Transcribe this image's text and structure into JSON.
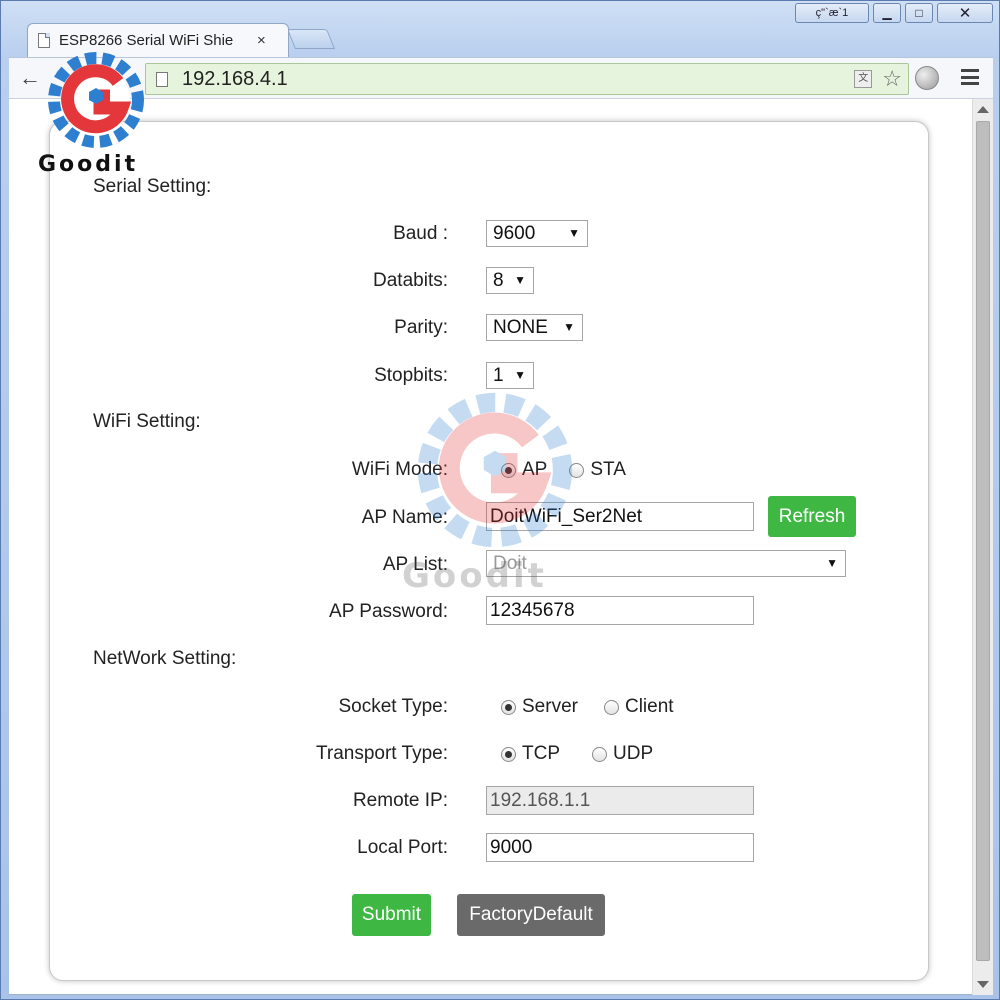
{
  "browser": {
    "tab_title": "ESP8266 Serial WiFi Shie",
    "tab_close": "×",
    "url": "192.168.4.1",
    "user_badge": "ç\"`æ`1",
    "min_glyph": "▁",
    "max_glyph": "□",
    "close_glyph": "✕",
    "back_glyph": "←",
    "reload_glyph": "C",
    "star_glyph": "☆",
    "translate_glyph": "文"
  },
  "serial": {
    "title": "Serial Setting:",
    "baud_label": "Baud :",
    "baud_value": "9600",
    "databits_label": "Databits:",
    "databits_value": "8",
    "parity_label": "Parity:",
    "parity_value": "NONE",
    "stopbits_label": "Stopbits:",
    "stopbits_value": "1"
  },
  "wifi": {
    "title": "WiFi Setting:",
    "mode_label": "WiFi Mode:",
    "mode_options": [
      "AP",
      "STA"
    ],
    "mode_selected": "AP",
    "ap_name_label": "AP Name:",
    "ap_name_value": "DoitWiFi_Ser2Net",
    "refresh_label": "Refresh",
    "ap_list_label": "AP List:",
    "ap_list_value": "Doit",
    "ap_password_label": "AP Password:",
    "ap_password_value": "12345678"
  },
  "network": {
    "title": "NetWork Setting:",
    "socket_label": "Socket Type:",
    "socket_options": [
      "Server",
      "Client"
    ],
    "socket_selected": "Server",
    "transport_label": "Transport Type:",
    "transport_options": [
      "TCP",
      "UDP"
    ],
    "transport_selected": "TCP",
    "remote_ip_label": "Remote IP:",
    "remote_ip_value": "192.168.1.1",
    "local_port_label": "Local Port:",
    "local_port_value": "9000"
  },
  "actions": {
    "submit_label": "Submit",
    "factory_label": "FactoryDefault"
  },
  "watermark": {
    "brand": "Goodit"
  },
  "colors": {
    "accent_green": "#3fb843",
    "button_gray": "#6a6a6a",
    "omnibox_green": "#e6f4dd"
  }
}
